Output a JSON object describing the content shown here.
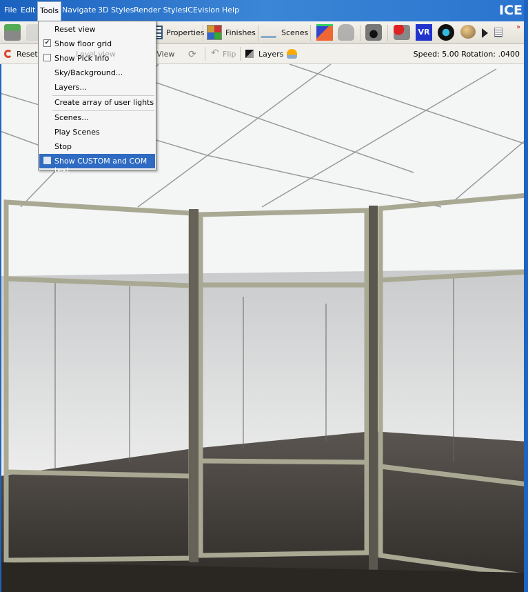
{
  "menubar": {
    "items": [
      "File",
      "Edit",
      "Tools",
      "Navigate",
      "3D Styles",
      "Render Styles",
      "ICEvision",
      "Help"
    ],
    "open": "Tools",
    "brand": "ICE"
  },
  "toolbar1": {
    "properties": "Properties",
    "finishes": "Finishes",
    "scenes": "Scenes"
  },
  "toolbar2": {
    "reset_view": "Reset View",
    "level_view": "Level view",
    "overhead_view": "Overhead View",
    "flip": "Flip",
    "layers": "Layers",
    "status": "Speed: 5.00 Rotation: .0400"
  },
  "tools_menu": {
    "items": [
      {
        "label": "Reset view",
        "check": null
      },
      {
        "label": "Show floor grid",
        "check": true
      },
      {
        "label": "Show Pick Info",
        "check": false
      },
      {
        "label": "Sky/Background...",
        "check": null
      },
      {
        "label": "Layers...",
        "check": null
      },
      {
        "label": "Create array of user lights",
        "check": null
      },
      {
        "label": "Scenes...",
        "check": null
      },
      {
        "label": "Play Scenes",
        "check": null
      },
      {
        "label": "Stop",
        "check": null
      },
      {
        "label": "Show CUSTOM and COM text",
        "check": false,
        "highlighted": true
      }
    ]
  },
  "colors": {
    "title_bar": "#1d63c2",
    "menu_highlight": "#2f6bc2",
    "frame": "#a9a893"
  }
}
